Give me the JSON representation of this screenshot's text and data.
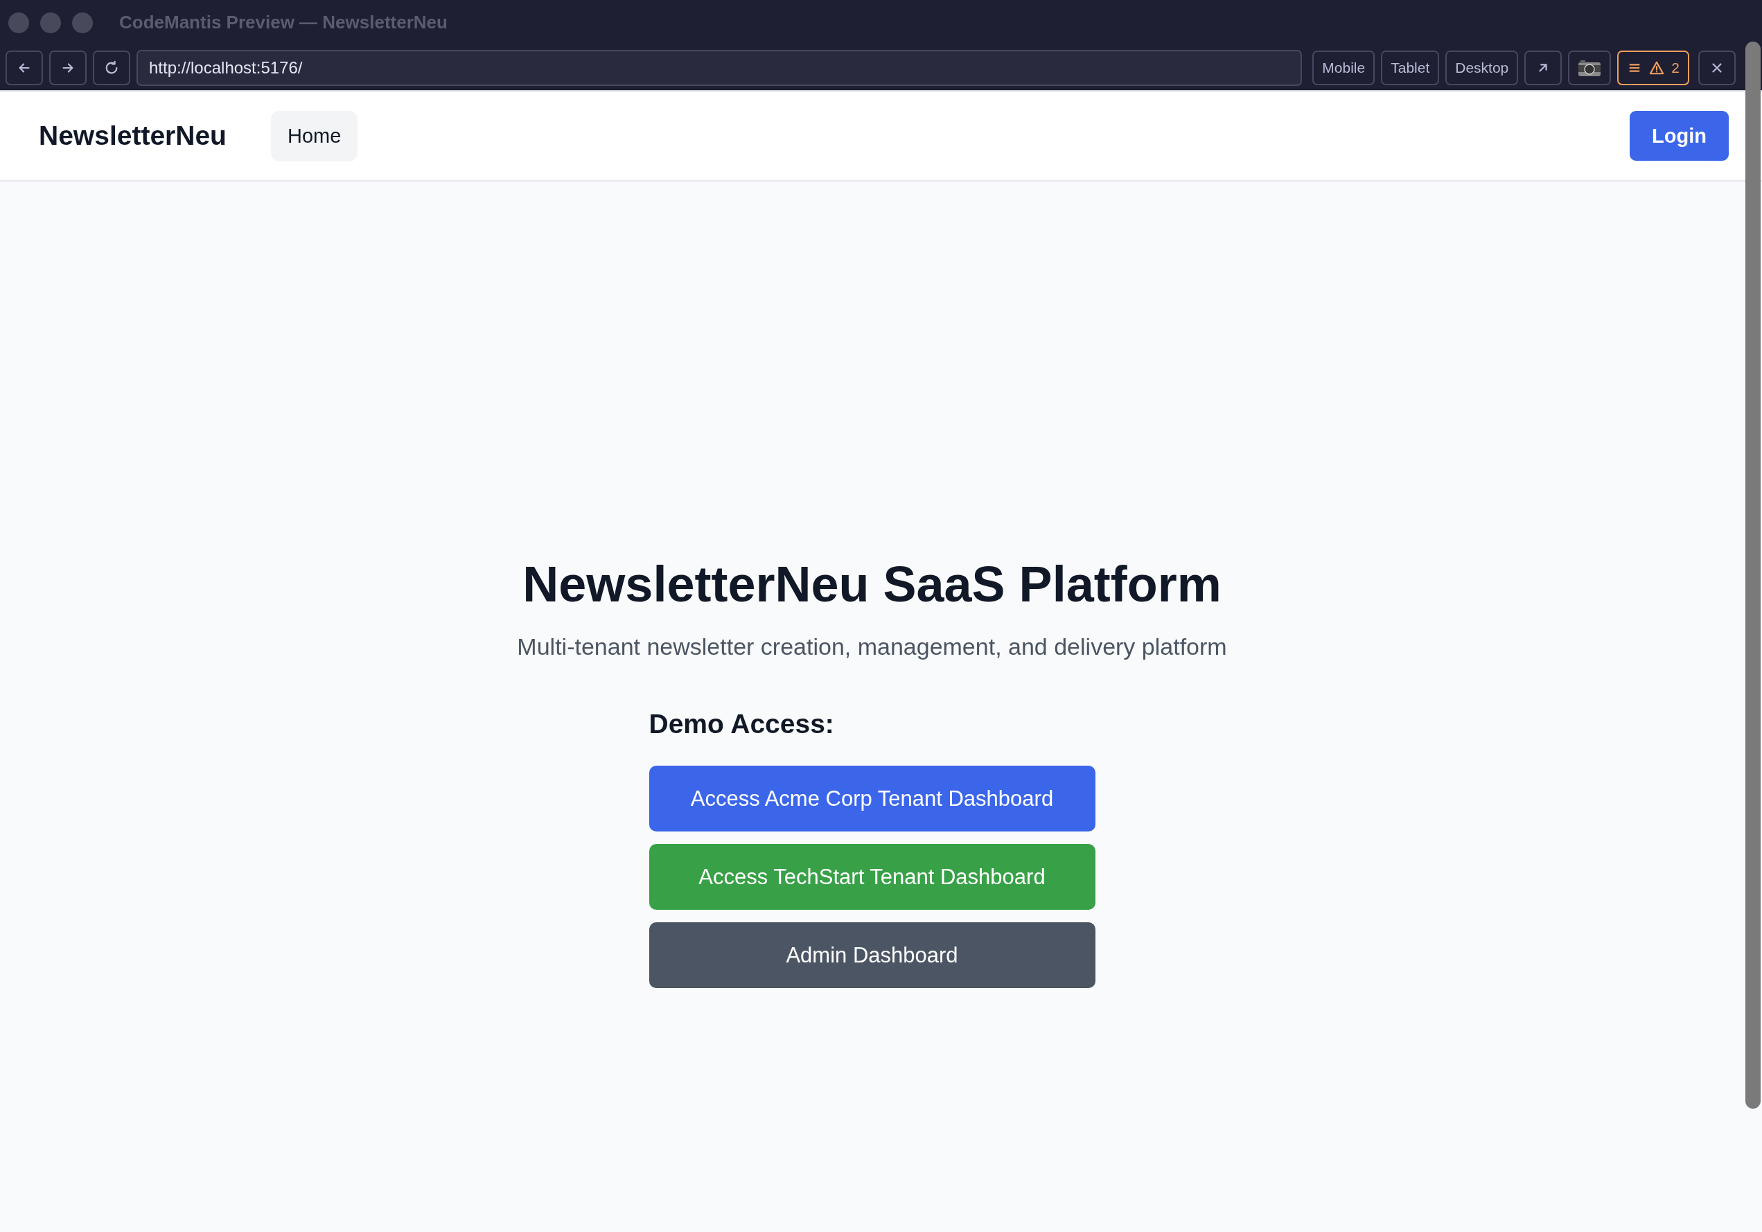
{
  "window": {
    "title": "CodeMantis Preview — NewsletterNeu"
  },
  "toolbar": {
    "url": "http://localhost:5176/",
    "devices": [
      "Mobile",
      "Tablet",
      "Desktop"
    ],
    "issues_count": "2"
  },
  "navbar": {
    "brand": "NewsletterNeu",
    "links": [
      {
        "label": "Home",
        "selected": true
      }
    ],
    "login": "Login"
  },
  "hero": {
    "title": "NewsletterNeu SaaS Platform",
    "subtitle": "Multi-tenant newsletter creation, management, and delivery platform"
  },
  "demo": {
    "heading": "Demo Access:",
    "buttons": [
      {
        "label": "Access Acme Corp Tenant Dashboard",
        "color": "#3b66ea"
      },
      {
        "label": "Access TechStart Tenant Dashboard",
        "color": "#38a147"
      },
      {
        "label": "Admin Dashboard",
        "color": "#4b5563"
      }
    ]
  }
}
